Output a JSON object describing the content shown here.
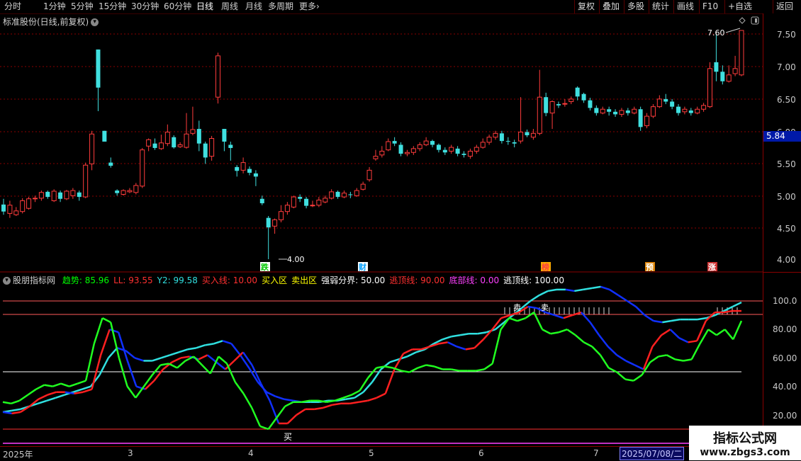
{
  "toolbar": {
    "periods": [
      "分时",
      "1分钟",
      "5分钟",
      "15分钟",
      "30分钟",
      "60分钟",
      "日线",
      "周线",
      "月线",
      "多周期",
      "更多"
    ],
    "active_period": "日线",
    "more_arrow": "›",
    "right_buttons": [
      "复权",
      "叠加",
      "多股",
      "统计",
      "画线",
      "F10",
      "+自选",
      "返回"
    ]
  },
  "main_chart": {
    "title": "标准股份(日线,前复权)",
    "high_label": "7.60",
    "low_label": "4.00",
    "current_price": "5.84",
    "y_ticks": [
      "7.50",
      "7.00",
      "6.50",
      "6.00",
      "5.50",
      "5.00",
      "4.50",
      "4.00"
    ],
    "markers": [
      {
        "text": "跌",
        "color": "#00c800",
        "bg": "#ffffff"
      },
      {
        "text": "财",
        "color": "#00a0ff",
        "bg": "#ffffff"
      },
      {
        "text": "榜",
        "color": "#ff4040",
        "bg": "#ffaa00"
      },
      {
        "text": "预",
        "color": "#ffffff",
        "bg": "#d88000"
      },
      {
        "text": "涨",
        "color": "#ffffff",
        "bg": "#cc3030"
      }
    ]
  },
  "indicator": {
    "name": "股朋指标网",
    "items": [
      {
        "label": "趋势: 85.96",
        "color": "#00ff00"
      },
      {
        "label": "LL: 93.55",
        "color": "#ff3030"
      },
      {
        "label": "Y2: 99.58",
        "color": "#30e0e0"
      },
      {
        "label": "买入线: 10.00",
        "color": "#ff3030"
      },
      {
        "label": "买入区",
        "color": "#ffff00"
      },
      {
        "label": "卖出区",
        "color": "#ffff00"
      },
      {
        "label": "强弱分界: 50.00",
        "color": "#ffffff"
      },
      {
        "label": "逃顶线: 90.00",
        "color": "#ff3030"
      },
      {
        "label": "底部线: 0.00",
        "color": "#ff40ff"
      },
      {
        "label": "逃顶线: 100.00",
        "color": "#ffffff"
      }
    ],
    "y_ticks": [
      "100.0",
      "80.00",
      "60.00",
      "40.00",
      "20.00"
    ],
    "buy_label": "买",
    "sell_label": "卖"
  },
  "date_axis": {
    "labels": [
      "2025年",
      "3",
      "4",
      "5",
      "6",
      "7"
    ],
    "selected": "2025/07/08/二"
  },
  "watermark": {
    "line1": "指标公式网",
    "line2": "www.zbgs3.com"
  },
  "chart_data": {
    "type": "candlestick",
    "title": "标准股份(日线,前复权)",
    "ylim": [
      4.0,
      7.7
    ],
    "candles": [
      [
        4.86,
        4.75,
        4.95,
        4.7
      ],
      [
        4.72,
        4.85,
        4.92,
        4.65
      ],
      [
        4.7,
        4.76,
        4.82,
        4.68
      ],
      [
        4.75,
        4.92,
        4.96,
        4.72
      ],
      [
        4.8,
        4.95,
        4.98,
        4.78
      ],
      [
        4.95,
        4.96,
        5.0,
        4.9
      ],
      [
        4.96,
        5.05,
        5.08,
        4.92
      ],
      [
        5.06,
        4.98,
        5.08,
        4.95
      ],
      [
        4.92,
        5.07,
        5.1,
        4.9
      ],
      [
        5.05,
        4.95,
        5.08,
        4.9
      ],
      [
        4.95,
        5.07,
        5.09,
        4.93
      ],
      [
        5.0,
        5.08,
        5.12,
        4.95
      ],
      [
        5.05,
        4.98,
        5.08,
        4.92
      ],
      [
        4.98,
        5.48,
        5.52,
        4.96
      ],
      [
        5.5,
        5.97,
        6.02,
        5.4
      ],
      [
        7.3,
        6.7,
        7.3,
        6.33
      ],
      [
        6.02,
        5.85,
        6.02,
        5.85
      ],
      [
        5.52,
        5.47,
        5.6,
        5.44
      ],
      [
        5.08,
        5.04,
        5.1,
        5.0
      ],
      [
        5.02,
        5.08,
        5.1,
        5.0
      ],
      [
        5.06,
        5.08,
        5.12,
        5.04
      ],
      [
        5.05,
        5.16,
        5.2,
        5.02
      ],
      [
        5.15,
        5.72,
        5.75,
        5.12
      ],
      [
        5.78,
        5.88,
        5.9,
        5.7
      ],
      [
        5.82,
        5.75,
        5.9,
        5.72
      ],
      [
        5.74,
        5.83,
        5.96,
        5.72
      ],
      [
        5.82,
        6.0,
        6.12,
        5.78
      ],
      [
        5.92,
        5.76,
        5.95,
        5.74
      ],
      [
        5.77,
        5.8,
        5.84,
        5.75
      ],
      [
        5.76,
        5.97,
        6.3,
        5.74
      ],
      [
        5.98,
        6.04,
        6.4,
        5.95
      ],
      [
        6.05,
        5.82,
        6.18,
        5.7
      ],
      [
        5.82,
        5.6,
        5.85,
        5.5
      ],
      [
        5.62,
        5.9,
        5.94,
        5.55
      ],
      [
        6.55,
        7.2,
        7.25,
        6.45
      ],
      [
        6.05,
        5.85,
        6.05,
        5.7
      ],
      [
        5.8,
        5.75,
        5.85,
        5.55
      ],
      [
        5.45,
        5.39,
        5.48,
        5.3
      ],
      [
        5.4,
        5.52,
        5.6,
        5.35
      ],
      [
        5.42,
        5.36,
        5.46,
        5.32
      ],
      [
        5.35,
        5.3,
        5.4,
        5.15
      ],
      [
        4.95,
        4.88,
        5.0,
        4.85
      ],
      [
        4.65,
        4.5,
        4.68,
        4.0
      ],
      [
        4.52,
        4.62,
        4.64,
        4.4
      ],
      [
        4.62,
        4.75,
        4.85,
        4.58
      ],
      [
        4.75,
        4.85,
        4.9,
        4.7
      ],
      [
        4.82,
        4.98,
        5.0,
        4.8
      ],
      [
        4.98,
        4.95,
        5.02,
        4.9
      ],
      [
        4.95,
        4.84,
        4.98,
        4.8
      ],
      [
        4.84,
        4.85,
        4.92,
        4.82
      ],
      [
        4.85,
        4.93,
        4.98,
        4.82
      ],
      [
        4.9,
        4.96,
        5.0,
        4.88
      ],
      [
        4.96,
        5.06,
        5.1,
        4.94
      ],
      [
        5.06,
        4.98,
        5.08,
        4.95
      ],
      [
        4.98,
        5.04,
        5.08,
        4.96
      ],
      [
        5.02,
        5.01,
        5.06,
        4.96
      ],
      [
        5.0,
        5.08,
        5.12,
        4.98
      ],
      [
        5.1,
        5.18,
        5.22,
        5.08
      ],
      [
        5.25,
        5.4,
        5.45,
        5.22
      ],
      [
        5.58,
        5.62,
        5.72,
        5.55
      ],
      [
        5.64,
        5.7,
        5.78,
        5.6
      ],
      [
        5.72,
        5.85,
        5.9,
        5.7
      ],
      [
        5.86,
        5.82,
        5.92,
        5.78
      ],
      [
        5.8,
        5.66,
        5.84,
        5.62
      ],
      [
        5.66,
        5.68,
        5.72,
        5.62
      ],
      [
        5.68,
        5.74,
        5.78,
        5.64
      ],
      [
        5.74,
        5.8,
        5.84,
        5.7
      ],
      [
        5.8,
        5.86,
        5.92,
        5.78
      ],
      [
        5.86,
        5.8,
        5.88,
        5.76
      ],
      [
        5.8,
        5.72,
        5.82,
        5.68
      ],
      [
        5.72,
        5.68,
        5.76,
        5.64
      ],
      [
        5.7,
        5.76,
        5.8,
        5.66
      ],
      [
        5.74,
        5.66,
        5.78,
        5.62
      ],
      [
        5.66,
        5.64,
        5.7,
        5.6
      ],
      [
        5.62,
        5.7,
        5.74,
        5.58
      ],
      [
        5.7,
        5.76,
        5.8,
        5.66
      ],
      [
        5.76,
        5.84,
        5.9,
        5.74
      ],
      [
        5.84,
        5.92,
        5.96,
        5.8
      ],
      [
        5.92,
        5.98,
        6.02,
        5.88
      ],
      [
        5.98,
        5.86,
        6.02,
        5.82
      ],
      [
        5.86,
        5.85,
        5.92,
        5.8
      ],
      [
        5.84,
        5.82,
        5.88,
        5.76
      ],
      [
        5.86,
        6.0,
        6.55,
        5.82
      ],
      [
        6.0,
        5.95,
        6.04,
        5.92
      ],
      [
        5.92,
        5.98,
        6.05,
        5.88
      ],
      [
        5.98,
        6.55,
        6.98,
        5.95
      ],
      [
        6.55,
        6.3,
        6.62,
        6.25
      ],
      [
        6.3,
        6.48,
        6.5,
        6.05
      ],
      [
        6.44,
        6.42,
        6.48,
        6.38
      ],
      [
        6.44,
        6.45,
        6.52,
        6.4
      ],
      [
        6.48,
        6.52,
        6.56,
        6.44
      ],
      [
        6.7,
        6.56,
        6.72,
        6.5
      ],
      [
        6.6,
        6.5,
        6.62,
        6.46
      ],
      [
        6.5,
        6.38,
        6.54,
        6.34
      ],
      [
        6.38,
        6.3,
        6.42,
        6.26
      ],
      [
        6.3,
        6.36,
        6.4,
        6.28
      ],
      [
        6.36,
        6.32,
        6.4,
        6.26
      ],
      [
        6.32,
        6.28,
        6.36,
        6.24
      ],
      [
        6.28,
        6.34,
        6.38,
        6.24
      ],
      [
        6.34,
        6.3,
        6.38,
        6.26
      ],
      [
        6.3,
        6.36,
        6.4,
        6.28
      ],
      [
        6.36,
        6.08,
        6.4,
        6.02
      ],
      [
        6.1,
        6.25,
        6.3,
        6.06
      ],
      [
        6.25,
        6.4,
        6.44,
        6.22
      ],
      [
        6.4,
        6.52,
        6.58,
        6.38
      ],
      [
        6.52,
        6.48,
        6.6,
        6.44
      ],
      [
        6.48,
        6.4,
        6.52,
        6.36
      ],
      [
        6.4,
        6.3,
        6.44,
        6.26
      ],
      [
        6.32,
        6.36,
        6.4,
        6.28
      ],
      [
        6.34,
        6.3,
        6.38,
        6.26
      ],
      [
        6.3,
        6.36,
        6.4,
        6.28
      ],
      [
        6.36,
        6.42,
        6.46,
        6.32
      ],
      [
        6.4,
        7.0,
        7.1,
        6.38
      ],
      [
        7.1,
        6.95,
        7.55,
        6.8
      ],
      [
        6.95,
        6.8,
        7.05,
        6.75
      ],
      [
        6.8,
        6.9,
        7.05,
        6.78
      ],
      [
        6.92,
        7.0,
        7.2,
        6.88
      ],
      [
        6.9,
        7.6,
        7.6,
        6.88
      ]
    ],
    "indicator_series": {
      "趋势": [
        29,
        28,
        30,
        34,
        38,
        41,
        40,
        42,
        40,
        42,
        44,
        70,
        88,
        85,
        60,
        40,
        32,
        40,
        48,
        55,
        56,
        53,
        58,
        61,
        55,
        49,
        61,
        56,
        43,
        35,
        25,
        12,
        10,
        18,
        26,
        29,
        29,
        30,
        30,
        29,
        30,
        32,
        34,
        37,
        46,
        53,
        54,
        53,
        51,
        50,
        53,
        55,
        54,
        52,
        52,
        51,
        51,
        51,
        52,
        56,
        80,
        88,
        86,
        88,
        92,
        80,
        77,
        78,
        80,
        76,
        71,
        68,
        62,
        53,
        50,
        45,
        44,
        48,
        57,
        61,
        62,
        59,
        58,
        59,
        70,
        80,
        76,
        80,
        73,
        86
      ],
      "LL": [
        22,
        21,
        22,
        26,
        31,
        34,
        36,
        36,
        35,
        36,
        38,
        62,
        80,
        78,
        58,
        40,
        38,
        44,
        52,
        57,
        60,
        61,
        59,
        62,
        57,
        52,
        58,
        64,
        55,
        42,
        30,
        14,
        14,
        20,
        24,
        24,
        25,
        27,
        28,
        28,
        29,
        30,
        32,
        35,
        52,
        63,
        66,
        66,
        68,
        70,
        71,
        68,
        66,
        67,
        73,
        80,
        88,
        90,
        92,
        96,
        95,
        92,
        90,
        88,
        90,
        92,
        85,
        76,
        68,
        62,
        58,
        55,
        52,
        68,
        76,
        80,
        74,
        71,
        72,
        86,
        92,
        92,
        93,
        93
      ],
      "Y2": [
        22,
        23,
        24,
        26,
        28,
        30,
        32,
        34,
        36,
        38,
        40,
        48,
        60,
        67,
        65,
        60,
        58,
        58,
        60,
        62,
        64,
        66,
        67,
        69,
        70,
        72,
        70,
        62,
        53,
        43,
        36,
        33,
        31,
        30,
        29,
        29,
        29,
        30,
        30,
        31,
        32,
        36,
        43,
        52,
        57,
        59,
        61,
        64,
        66,
        70,
        73,
        75,
        76,
        77,
        77,
        78,
        80,
        85,
        90,
        95,
        100,
        104,
        107,
        108,
        108,
        107,
        108,
        109,
        110,
        108,
        104,
        100,
        96,
        90,
        86,
        85,
        86,
        87,
        87,
        87,
        88,
        90,
        93,
        96,
        99
      ]
    },
    "indicator_levels": {
      "buy_line": 10,
      "weak_strong": 50,
      "escape_top_90": 90,
      "escape_top_100": 100,
      "bottom": 0
    }
  }
}
